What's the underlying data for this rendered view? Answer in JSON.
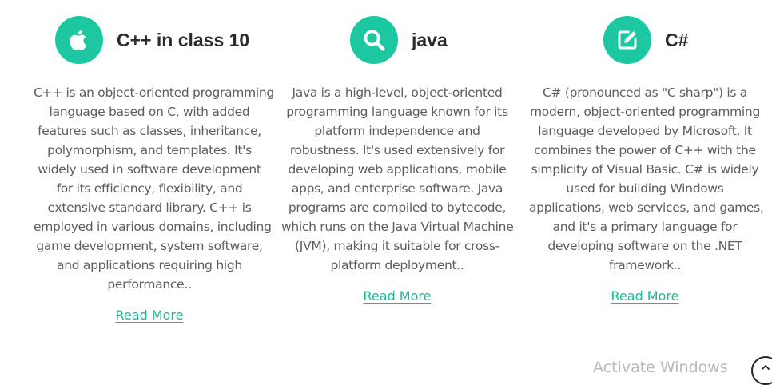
{
  "cards": [
    {
      "icon": "apple-icon",
      "title": "C++ in class 10",
      "lines": [
        "C++ is an object-oriented programming",
        "language based on C, with added",
        "features such as classes, inheritance,",
        "polymorphism, and templates. It's",
        "widely used in software development",
        "for its efficiency, flexibility, and",
        "extensive standard library. C++ is",
        "employed in various domains, including",
        "game development, system software,",
        "and applications requiring high",
        "performance.."
      ],
      "link": "Read More"
    },
    {
      "icon": "search-icon",
      "title": "java",
      "lines": [
        "Java is a high-level, object-oriented",
        "programming language known for its",
        "platform independence and",
        "robustness. It's used extensively for",
        "developing web applications, mobile",
        "apps, and enterprise software. Java",
        "programs are compiled to bytecode,",
        "which runs on the Java Virtual Machine",
        "(JVM), making it suitable for cross-",
        "platform deployment.."
      ],
      "link": "Read More"
    },
    {
      "icon": "edit-icon",
      "title": "C#",
      "lines": [
        "C# (pronounced as \"C sharp\") is a",
        "modern, object-oriented programming",
        "language developed by Microsoft. It",
        "combines the power of C++ with the",
        "simplicity of Visual Basic. C# is widely",
        "used for building Windows",
        "applications, web services, and games,",
        "and it's a primary language for",
        "developing software on the .NET",
        "framework.."
      ],
      "link": "Read More"
    }
  ],
  "watermark": "Activate Windows",
  "colors": {
    "accent": "#1cc7a1",
    "title": "#2b2b2b",
    "text": "#5d5d5d",
    "link": "#1cb893"
  }
}
